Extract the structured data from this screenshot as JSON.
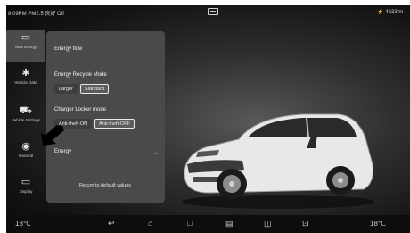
{
  "status_bar": {
    "left_text": "8:09PM PM2.5 良好 Off",
    "right_text": "⚡ 4633mi"
  },
  "side_rail": [
    {
      "label": "New Energy",
      "icon": "battery-icon"
    },
    {
      "label": "Vehicle Data",
      "icon": "fan-icon"
    },
    {
      "label": "Vehicle Settings",
      "icon": "car-icon"
    },
    {
      "label": "General",
      "icon": "gauge-icon"
    },
    {
      "label": "Display",
      "icon": "screen-icon"
    }
  ],
  "panel": {
    "energy_flow_title": "Energy flow",
    "recycle_title": "Energy Recycle Mode",
    "recycle_options": [
      "Larger",
      "Standard"
    ],
    "recycle_selected": "Standard",
    "charger_title": "Charger Locker mode",
    "charger_options": [
      "Anti-theft-ON",
      "Anti-theft-OFF"
    ],
    "charger_selected": "Anti-theft-OFF",
    "energy_title": "Energy",
    "reset_label": "Return to default values"
  },
  "dock": {
    "left_temp": "18℃",
    "right_temp": "18℃",
    "icons": [
      "back-icon",
      "home-icon",
      "square-icon",
      "bag-icon",
      "book-icon",
      "radio-icon"
    ]
  }
}
